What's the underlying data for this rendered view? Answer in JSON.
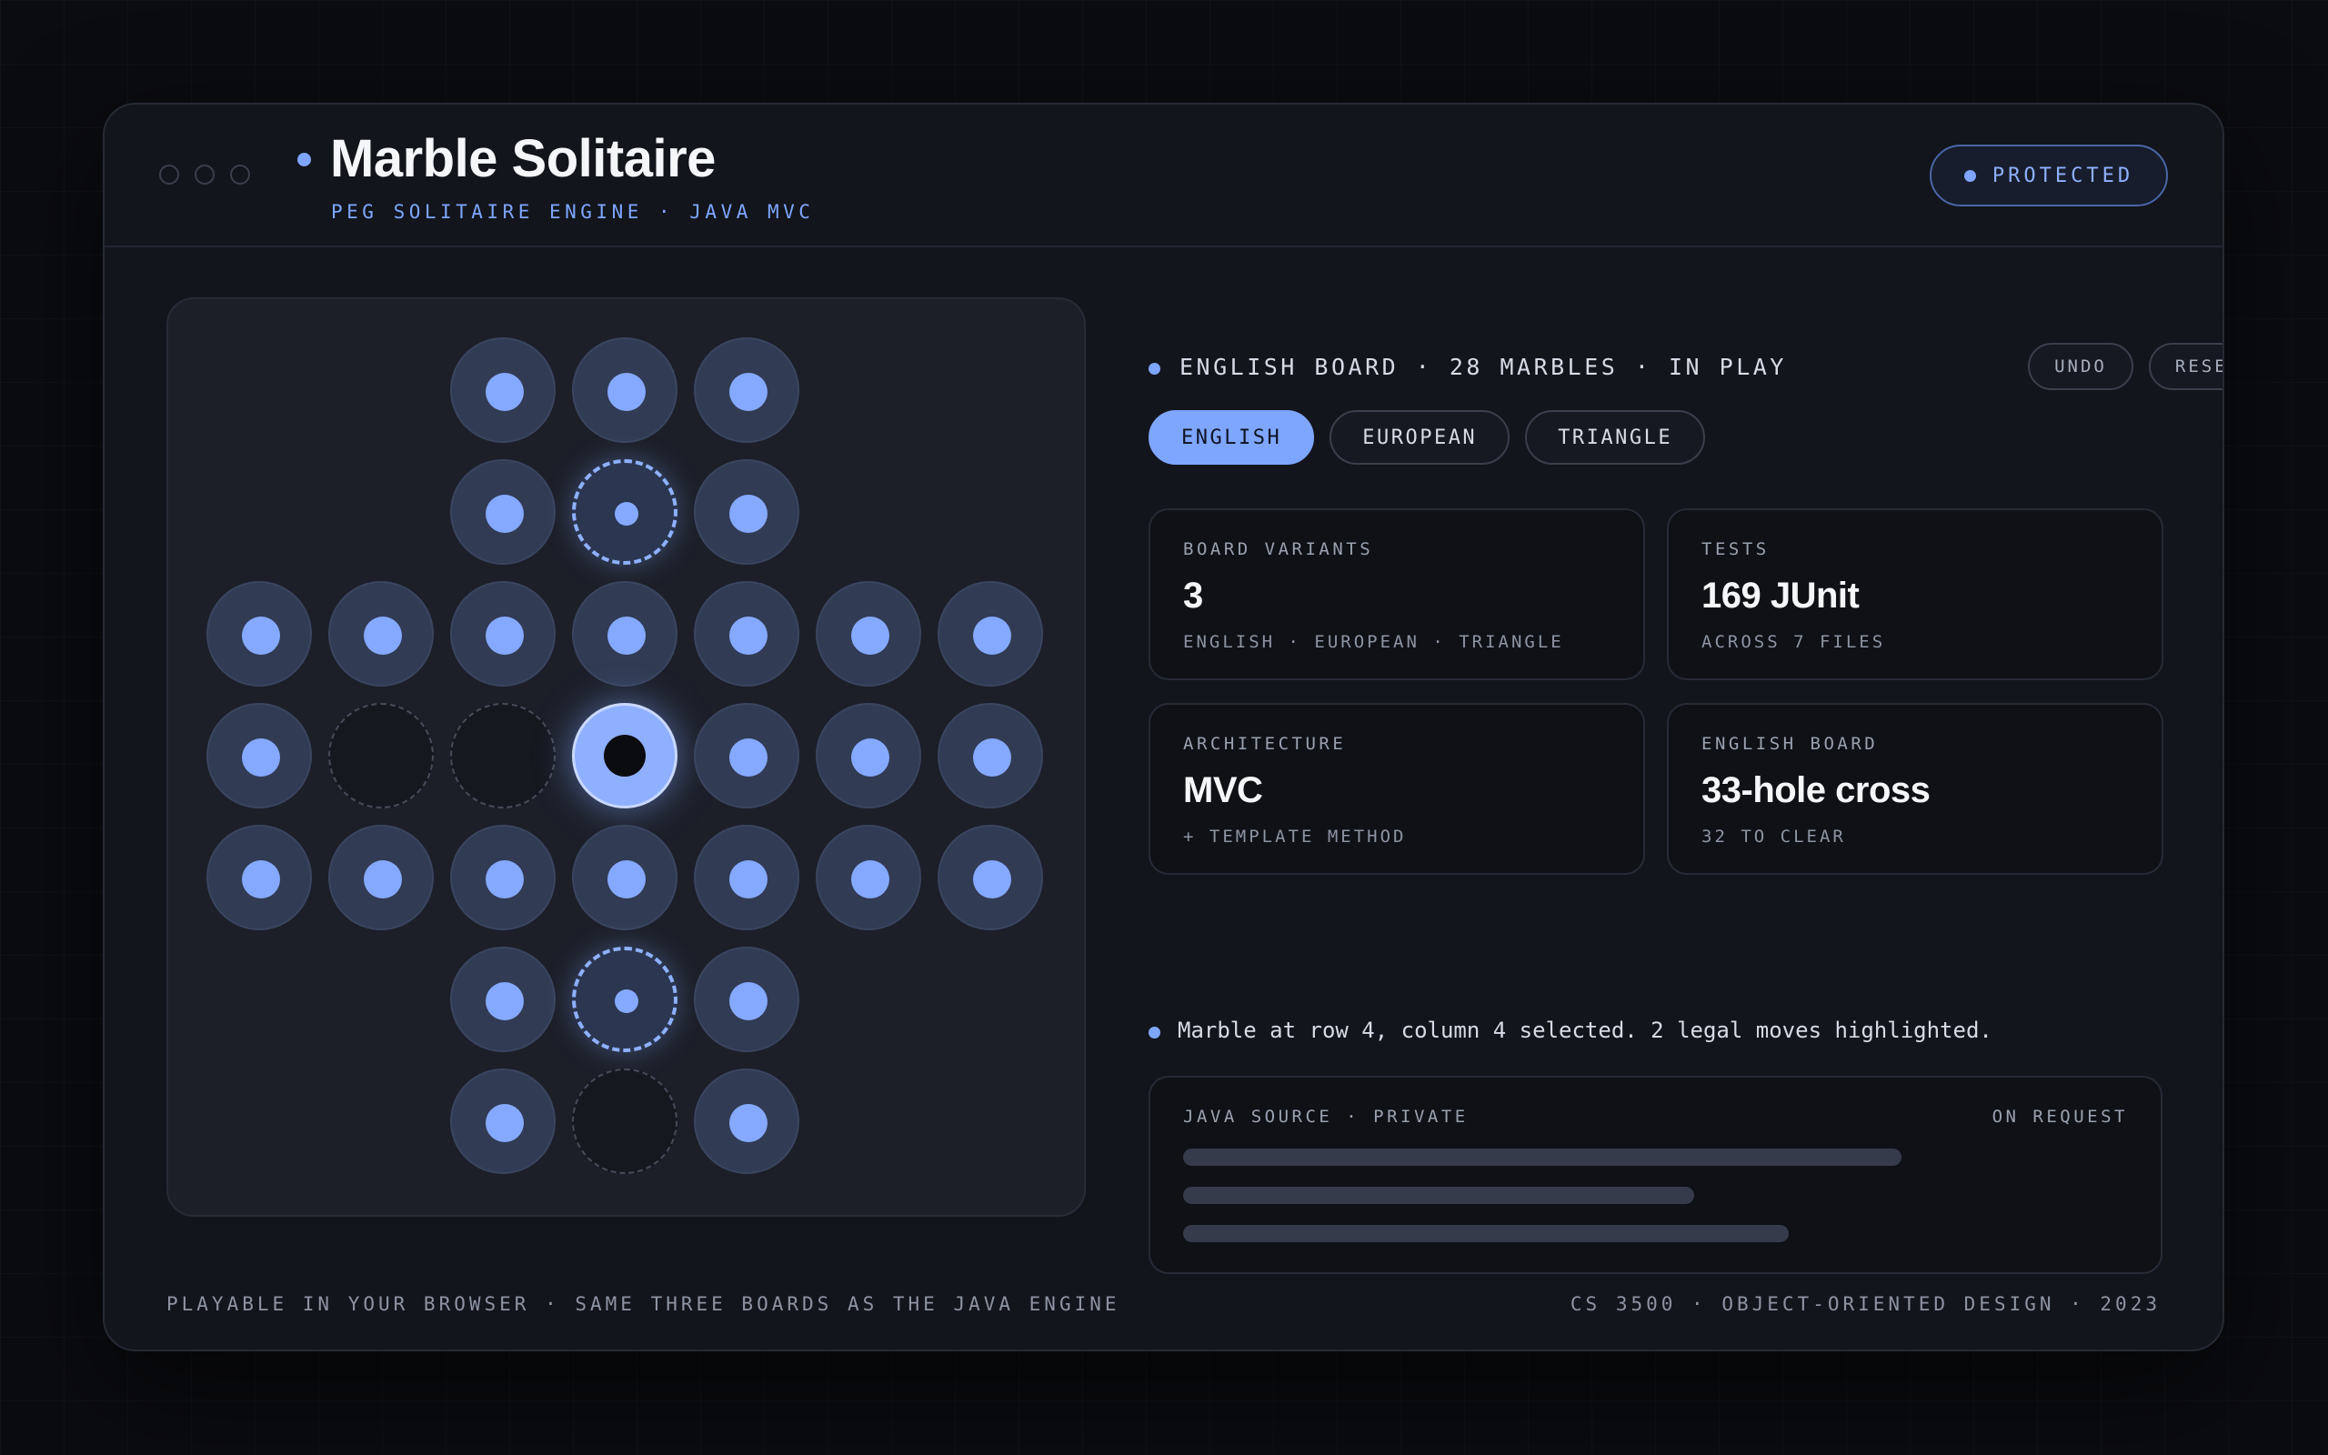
{
  "header": {
    "title": "Marble Solitaire",
    "subtitle": "PEG SOLITAIRE ENGINE · JAVA MVC",
    "badge": "PROTECTED"
  },
  "board": {
    "variant": "english",
    "selected": {
      "row": 4,
      "col": 4
    },
    "rows": [
      "  PPP  ",
      "  PTP  ",
      "PPPPPPP",
      "PEESPPP",
      "PPPPPPP",
      "  PTP  ",
      "  PEP  "
    ],
    "legend": {
      "P": "marble",
      "E": "empty",
      "T": "legal-move-target",
      "S": "selected-marble"
    }
  },
  "status": {
    "text": "ENGLISH BOARD · 28 MARBLES · IN PLAY",
    "undo_label": "UNDO",
    "reset_label": "RESET"
  },
  "tabs": [
    {
      "label": "ENGLISH",
      "active": true
    },
    {
      "label": "EUROPEAN",
      "active": false
    },
    {
      "label": "TRIANGLE",
      "active": false
    }
  ],
  "cards": [
    {
      "key": "BOARD VARIANTS",
      "value": "3",
      "sub": "ENGLISH · EUROPEAN · TRIANGLE"
    },
    {
      "key": "TESTS",
      "value": "169 JUnit",
      "sub": "ACROSS 7 FILES"
    },
    {
      "key": "ARCHITECTURE",
      "value": "MVC",
      "sub": "+ TEMPLATE METHOD"
    },
    {
      "key": "ENGLISH BOARD",
      "value": "33-hole cross",
      "sub": "32 TO CLEAR"
    }
  ],
  "message": "Marble at row 4, column 4 selected. 2 legal moves highlighted.",
  "source": {
    "label": "JAVA SOURCE · PRIVATE",
    "right_label": "ON REQUEST"
  },
  "footer": {
    "left": "PLAYABLE IN YOUR BROWSER · SAME THREE BOARDS AS THE JAVA ENGINE",
    "right": "CS 3500 · OBJECT-ORIENTED DESIGN · 2023"
  },
  "colors": {
    "accent": "#7ea6ff",
    "background": "#0b0c10",
    "panel": "#13151c"
  }
}
